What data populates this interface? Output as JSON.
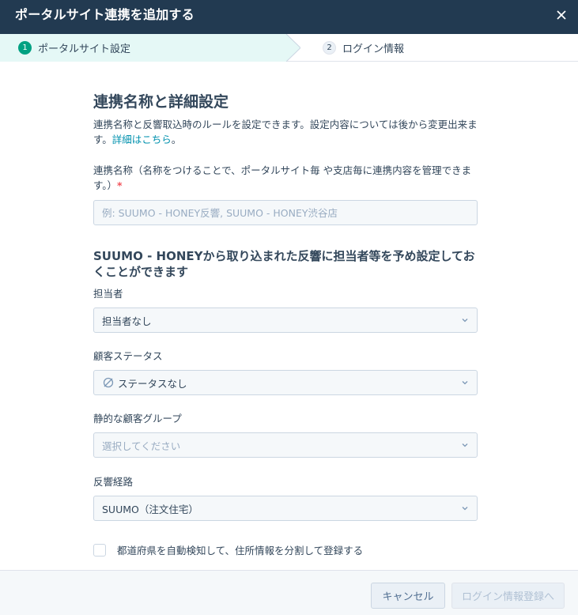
{
  "header": {
    "title": "ポータルサイト連携を追加する"
  },
  "steps": [
    {
      "number": "1",
      "label": "ポータルサイト設定"
    },
    {
      "number": "2",
      "label": "ログイン情報"
    }
  ],
  "section": {
    "title": "連携名称と詳細設定",
    "description": "連携名称と反響取込時のルールを設定できます。設定内容については後から変更出来ます。",
    "link": "詳細はこちら",
    "after_link": "。"
  },
  "name_field": {
    "label": "連携名称（名称をつけることで、ポータルサイト毎 や支店毎に連携内容を管理できます。）",
    "required_mark": "*",
    "placeholder": "例: SUUMO - HONEY反響, SUUMO - HONEY渋谷店",
    "value": ""
  },
  "subsection": {
    "title": "SUUMO - HONEYから取り込まれた反響に担当者等を予め設定しておくことができます"
  },
  "fields": {
    "owner": {
      "label": "担当者",
      "value": "担当者なし"
    },
    "status": {
      "label": "顧客ステータス",
      "value": "ステータスなし"
    },
    "group": {
      "label": "静的な顧客グループ",
      "placeholder": "選択してください"
    },
    "channel": {
      "label": "反響経路",
      "value": "SUUMO（注文住宅）"
    }
  },
  "checkbox": {
    "label": "都道府県を自動検知して、住所情報を分割して登録する",
    "checked": false
  },
  "footer": {
    "cancel_label": "キャンセル",
    "next_label": "ログイン情報登録へ"
  },
  "icons": {
    "close": "close-icon",
    "chevron": "chevron-down-icon",
    "empty": "empty-set-icon"
  },
  "colors": {
    "header_bg": "#223a51",
    "step_active_bg": "#e5f8f6",
    "step_badge": "#00a182",
    "link": "#0091ae",
    "required": "#f2545b"
  }
}
